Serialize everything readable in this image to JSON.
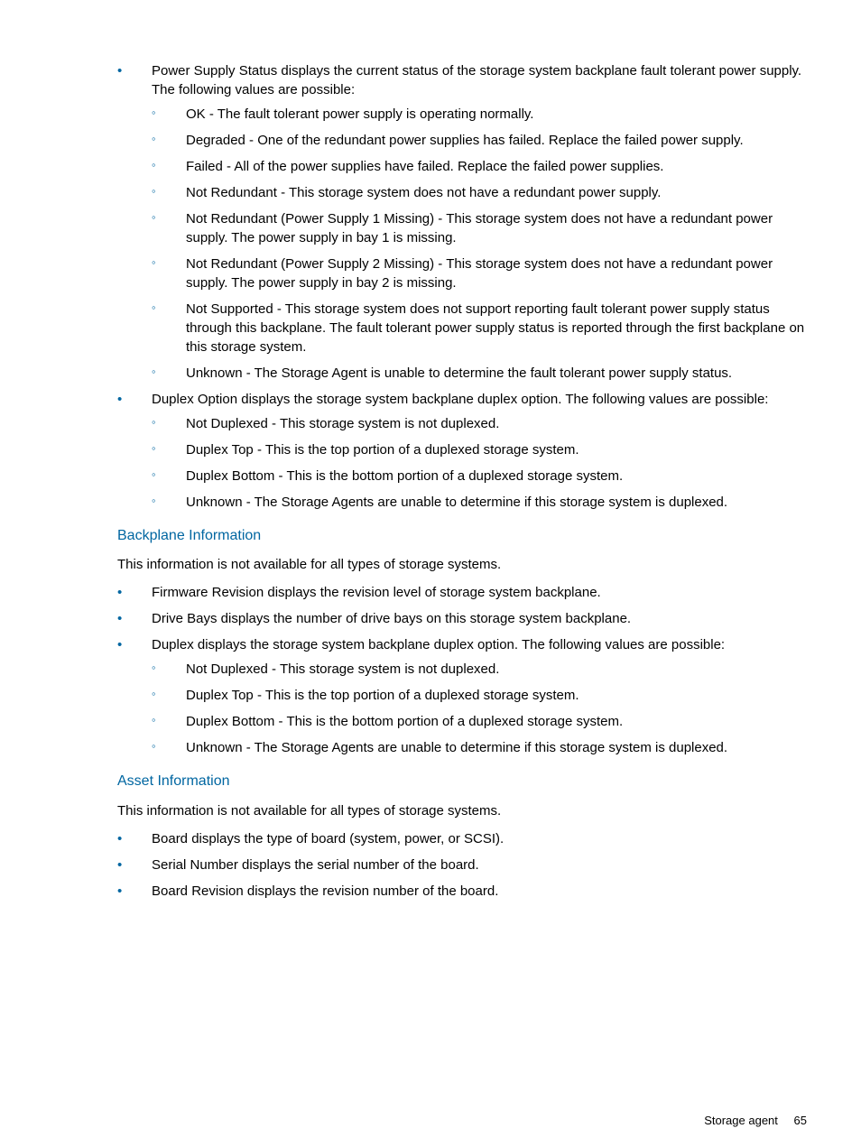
{
  "section1": {
    "items": [
      {
        "text": "Power Supply Status displays the current status of the storage system backplane fault tolerant power supply. The following values are possible:",
        "subitems": [
          "OK - The fault tolerant power supply is operating normally.",
          "Degraded - One of the redundant power supplies has failed. Replace the failed power supply.",
          "Failed - All of the power supplies have failed. Replace the failed power supplies.",
          "Not Redundant - This storage system does not have a redundant power supply.",
          "Not Redundant (Power Supply 1 Missing) - This storage system does not have a redundant power supply. The power supply in bay 1 is missing.",
          "Not Redundant (Power Supply 2 Missing) - This storage system does not have a redundant power supply. The power supply in bay 2 is missing.",
          "Not Supported - This storage system does not support reporting fault tolerant power supply status through this backplane. The fault tolerant power supply status is reported through the first backplane on this storage system.",
          "Unknown - The Storage Agent is unable to determine the fault tolerant power supply status."
        ]
      },
      {
        "text": "Duplex Option displays the storage system backplane duplex option. The following values are possible:",
        "subitems": [
          "Not Duplexed - This storage system is not duplexed.",
          "Duplex Top - This is the top portion of a duplexed storage system.",
          "Duplex Bottom - This is the bottom portion of a duplexed storage system.",
          "Unknown - The Storage Agents are unable to determine if this storage system is duplexed."
        ]
      }
    ]
  },
  "section2": {
    "heading": "Backplane Information",
    "intro": "This information is not available for all types of storage systems.",
    "items": [
      {
        "text": "Firmware Revision displays the revision level of storage system backplane.",
        "subitems": []
      },
      {
        "text": "Drive Bays displays the number of drive bays on this storage system backplane.",
        "subitems": []
      },
      {
        "text": "Duplex displays the storage system backplane duplex option. The following values are possible:",
        "subitems": [
          "Not Duplexed - This storage system is not duplexed.",
          "Duplex Top - This is the top portion of a duplexed storage system.",
          "Duplex Bottom - This is the bottom portion of a duplexed storage system.",
          "Unknown - The Storage Agents are unable to determine if this storage system is duplexed."
        ]
      }
    ]
  },
  "section3": {
    "heading": "Asset Information",
    "intro": "This information is not available for all types of storage systems.",
    "items": [
      {
        "text": "Board displays the type of board (system, power, or SCSI).",
        "subitems": []
      },
      {
        "text": "Serial Number displays the serial number of the board.",
        "subitems": []
      },
      {
        "text": "Board Revision displays the revision number of the board.",
        "subitems": []
      }
    ]
  },
  "footer": {
    "text": "Storage agent",
    "page": "65"
  }
}
